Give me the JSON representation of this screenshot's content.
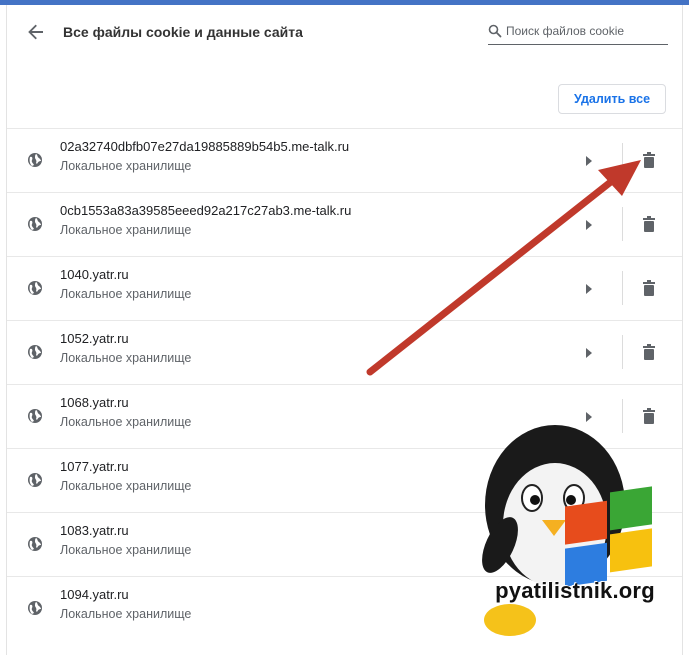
{
  "header": {
    "title": "Все файлы cookie и данные сайта",
    "search_placeholder": "Поиск файлов cookie"
  },
  "toolbar": {
    "remove_all_label": "Удалить все"
  },
  "sites": [
    {
      "name": "02a32740dbfb07e27da19885889b54b5.me-talk.ru",
      "detail": "Локальное хранилище",
      "has_actions": true
    },
    {
      "name": "0cb1553a83a39585eeed92a217c27ab3.me-talk.ru",
      "detail": "Локальное хранилище",
      "has_actions": true
    },
    {
      "name": "1040.yatr.ru",
      "detail": "Локальное хранилище",
      "has_actions": true
    },
    {
      "name": "1052.yatr.ru",
      "detail": "Локальное хранилище",
      "has_actions": true
    },
    {
      "name": "1068.yatr.ru",
      "detail": "Локальное хранилище",
      "has_actions": true
    },
    {
      "name": "1077.yatr.ru",
      "detail": "Локальное хранилище",
      "has_actions": false
    },
    {
      "name": "1083.yatr.ru",
      "detail": "Локальное хранилище",
      "has_actions": false
    },
    {
      "name": "1094.yatr.ru",
      "detail": "Локальное хранилище",
      "has_actions": false
    }
  ],
  "icons": {
    "back": "arrow-back-icon",
    "search": "search-icon",
    "site": "globe-icon",
    "expand": "chevron-right-icon",
    "delete": "trash-icon"
  },
  "watermark": {
    "text": "pyatilistnik.org"
  },
  "colors": {
    "accent": "#1a73e8",
    "annotation_arrow": "#c0392b",
    "top_bar": "#4473c5"
  }
}
